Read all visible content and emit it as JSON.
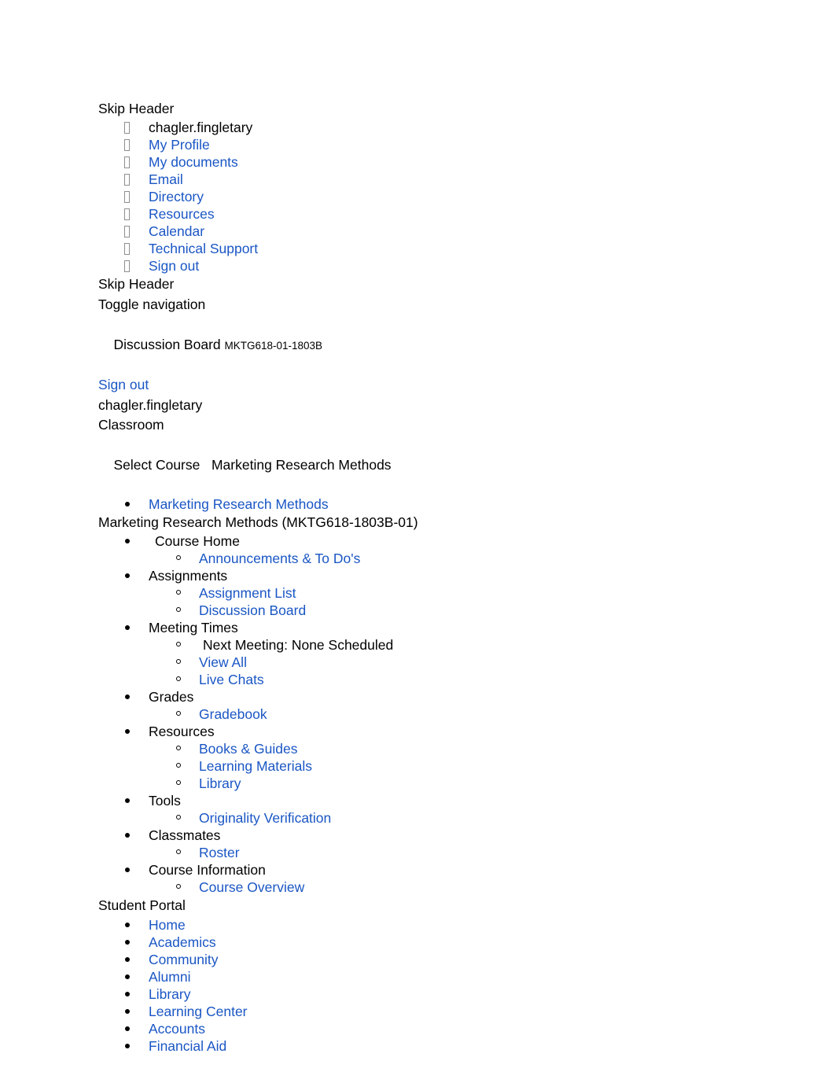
{
  "document": {
    "skip_header_top": "Skip Header",
    "skip_header_second": "Skip Header",
    "toggle_navigation": "Toggle navigation",
    "discussion_board_title": "Discussion Board",
    "course_code_badge": "MKTG618-01-1803B",
    "sign_out_link": "Sign out",
    "username_line": "chagler.fingletary",
    "classroom_label": "Classroom",
    "select_course_label": "Select Course",
    "select_course_value": "Marketing Research Methods",
    "course_nav_heading": "Marketing Research Methods (MKTG618-1803B-01)",
    "student_portal_heading": "Student Portal"
  },
  "colors": {
    "link": "#1a56c4",
    "text": "#000000",
    "background": "#ffffff",
    "tofu_border": "#8f8f8f"
  },
  "user_menu": [
    {
      "label": "chagler.fingletary",
      "is_link": false,
      "marker": "tofu-box-icon"
    },
    {
      "label": "My Profile",
      "is_link": true,
      "marker": "tofu-box-icon"
    },
    {
      "label": "My documents",
      "is_link": true,
      "marker": "tofu-box-icon"
    },
    {
      "label": "Email",
      "is_link": true,
      "marker": "tofu-box-icon"
    },
    {
      "label": "Directory",
      "is_link": true,
      "marker": "tofu-box-icon"
    },
    {
      "label": "Resources",
      "is_link": true,
      "marker": "tofu-box-icon"
    },
    {
      "label": "Calendar",
      "is_link": true,
      "marker": "tofu-box-icon"
    },
    {
      "label": "Technical Support",
      "is_link": true,
      "marker": "tofu-box-icon"
    },
    {
      "label": "Sign out",
      "is_link": true,
      "marker": "tofu-box-icon"
    }
  ],
  "course_selector": [
    {
      "label": "Marketing Research Methods",
      "is_link": true,
      "marker": "filled-bullet-icon"
    }
  ],
  "course_nav": [
    {
      "label": "Course Home",
      "is_link": false,
      "extra_lead_space": true,
      "children": [
        {
          "label": "Announcements & To Do's",
          "is_link": true
        }
      ]
    },
    {
      "label": "Assignments",
      "is_link": false,
      "extra_lead_space": false,
      "children": [
        {
          "label": "Assignment List",
          "is_link": true
        },
        {
          "label": "Discussion Board",
          "is_link": true
        }
      ]
    },
    {
      "label": "Meeting Times",
      "is_link": false,
      "extra_lead_space": false,
      "children": [
        {
          "label": "Next Meeting: None Scheduled",
          "is_link": false,
          "indent_extra": true
        },
        {
          "label": "View All",
          "is_link": true
        },
        {
          "label": "Live Chats",
          "is_link": true
        }
      ]
    },
    {
      "label": "Grades",
      "is_link": false,
      "extra_lead_space": false,
      "children": [
        {
          "label": "Gradebook",
          "is_link": true
        }
      ]
    },
    {
      "label": "Resources",
      "is_link": false,
      "extra_lead_space": false,
      "children": [
        {
          "label": "Books & Guides",
          "is_link": true
        },
        {
          "label": "Learning Materials",
          "is_link": true
        },
        {
          "label": "Library",
          "is_link": true
        }
      ]
    },
    {
      "label": "Tools",
      "is_link": false,
      "extra_lead_space": false,
      "children": [
        {
          "label": "Originality Verification",
          "is_link": true
        }
      ]
    },
    {
      "label": "Classmates",
      "is_link": false,
      "extra_lead_space": false,
      "children": [
        {
          "label": "Roster",
          "is_link": true
        }
      ]
    },
    {
      "label": "Course Information",
      "is_link": false,
      "extra_lead_space": false,
      "children": [
        {
          "label": "Course Overview",
          "is_link": true
        }
      ]
    }
  ],
  "student_portal_links": [
    {
      "label": "Home",
      "is_link": true
    },
    {
      "label": "Academics",
      "is_link": true
    },
    {
      "label": "Community",
      "is_link": true
    },
    {
      "label": "Alumni",
      "is_link": true
    },
    {
      "label": "Library",
      "is_link": true
    },
    {
      "label": "Learning Center",
      "is_link": true
    },
    {
      "label": "Accounts",
      "is_link": true
    },
    {
      "label": "Financial Aid",
      "is_link": true
    }
  ]
}
